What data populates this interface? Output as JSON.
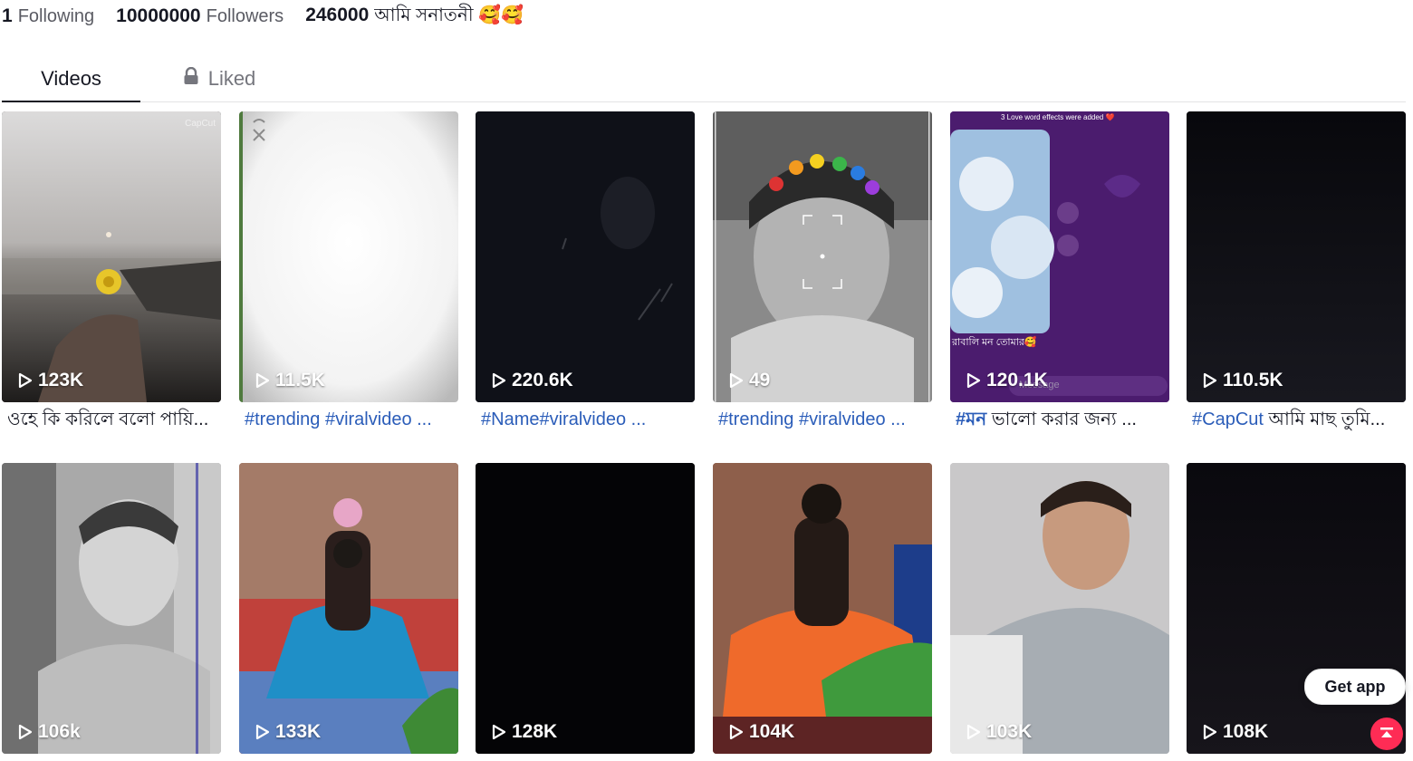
{
  "stats": {
    "following_count": "1",
    "following_label": "Following",
    "followers_count": "10000000",
    "followers_label": "Followers",
    "likes_count": "246000",
    "likes_label": "আমি সনাতনী 🥰🥰"
  },
  "tabs": [
    {
      "label": "Videos",
      "active": true
    },
    {
      "label": "Liked",
      "active": false,
      "icon": "lock-icon"
    }
  ],
  "videos": [
    {
      "views": "123K",
      "caption_text": "ওহে কি করিলে বলো পায়ি...",
      "tags": []
    },
    {
      "views": "11.5K",
      "caption_text": "",
      "tags": [
        "#trending #viralvideo ..."
      ]
    },
    {
      "views": "220.6K",
      "caption_text": "",
      "tags": [
        "#Name#viralvideo ..."
      ]
    },
    {
      "views": "49",
      "caption_text": "",
      "tags": [
        "#trending #viralvideo ..."
      ]
    },
    {
      "views": "120.1K",
      "caption_text": " ভালো করার জন্য ...",
      "tags": [
        "#মন"
      ]
    },
    {
      "views": "110.5K",
      "caption_text": " আমি মাছ তুমি...",
      "tags": [
        "#CapCut"
      ]
    },
    {
      "views": "106k"
    },
    {
      "views": "133K"
    },
    {
      "views": "128K"
    },
    {
      "views": "104K"
    },
    {
      "views": "103K"
    },
    {
      "views": "108K"
    }
  ],
  "overlay_texts": {
    "capcut_watermark": "CapCut",
    "love_effects": "3 Love word effects were added ❤️",
    "chat_line": "রাবালি মন তোমার🥰",
    "message_placeholder": "Message"
  },
  "get_app_label": "Get app",
  "colors": {
    "hashtag": "#2b5db9",
    "accent": "#fe2c55",
    "muted_text": "#5a5b63"
  }
}
